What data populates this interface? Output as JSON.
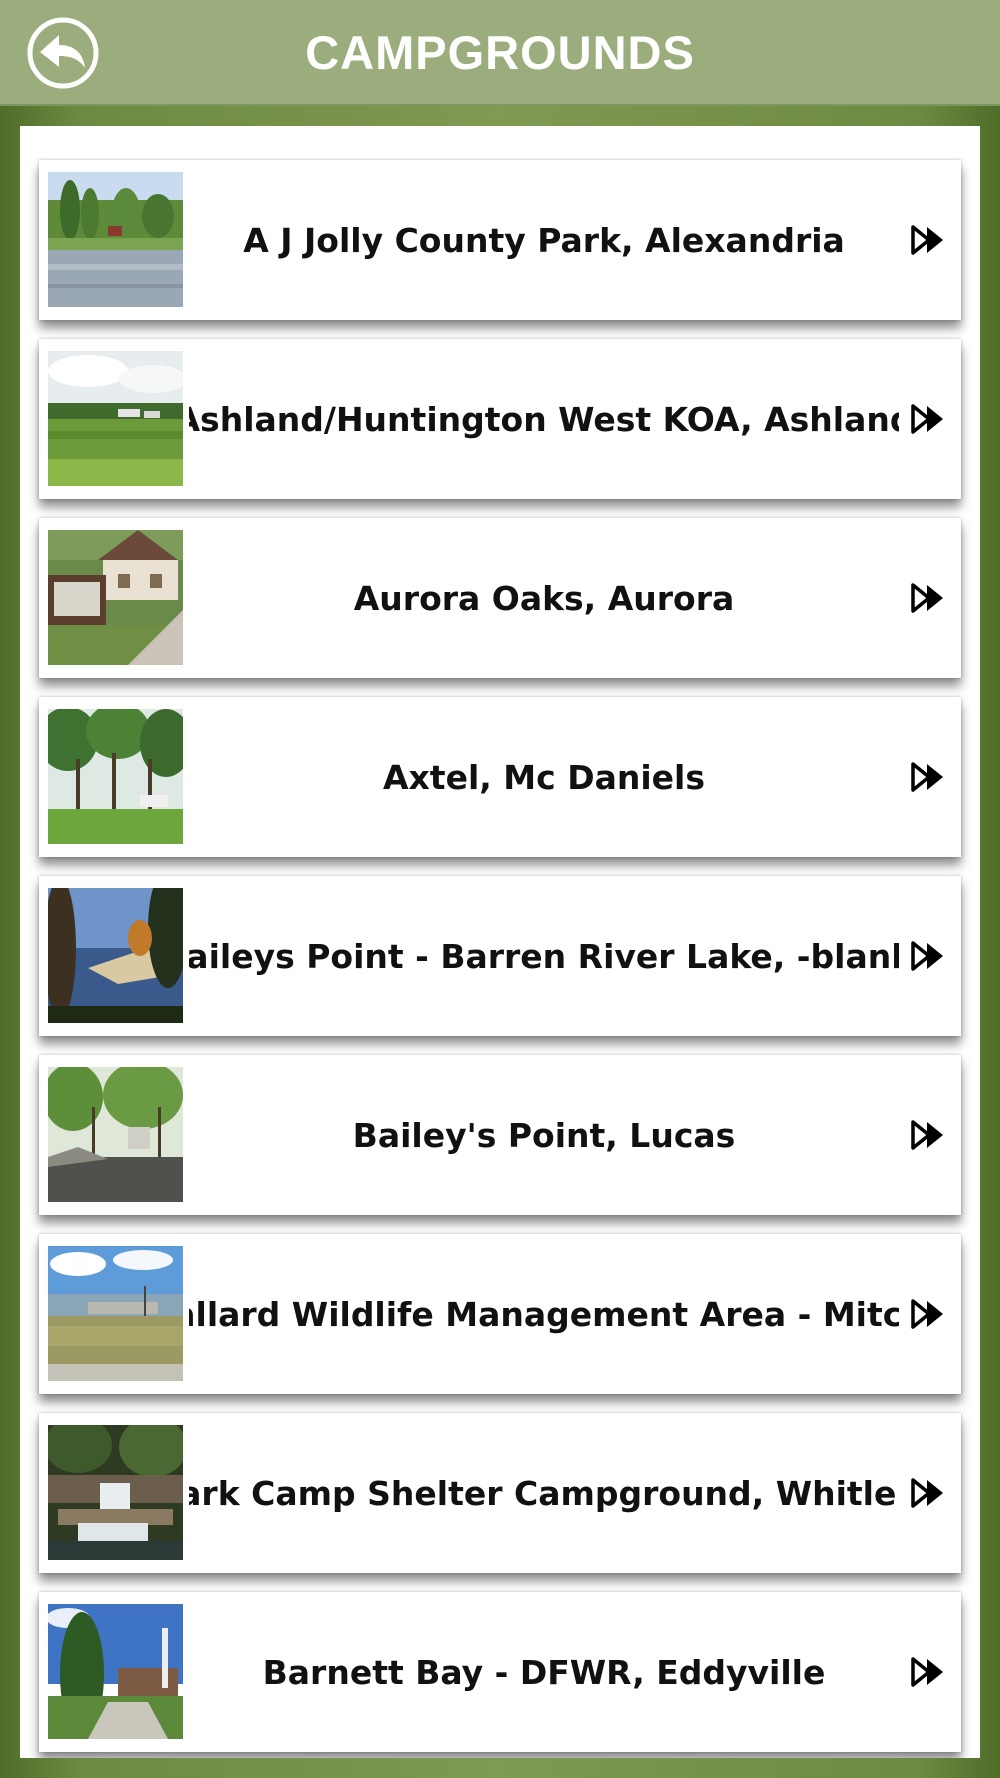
{
  "header": {
    "title": "CAMPGROUNDS",
    "back_icon": "back-arrow-icon"
  },
  "colors": {
    "header_bg": "#9bad7c",
    "frame": "#6d8a41",
    "title_text": "#ffffff",
    "row_text": "#111111"
  },
  "campgrounds": [
    {
      "name": "A J Jolly County Park, Alexandria",
      "thumb": "lake-trees-photo"
    },
    {
      "name": "Ashland/Huntington West KOA, Ashland",
      "thumb": "meadow-rv-photo"
    },
    {
      "name": "Aurora Oaks, Aurora",
      "thumb": "office-sign-photo"
    },
    {
      "name": "Axtel, Mc Daniels",
      "thumb": "forest-campsite-photo"
    },
    {
      "name": "Baileys Point - Barren River Lake, -blank-",
      "thumb": "lakeshore-photo"
    },
    {
      "name": "Bailey's Point, Lucas",
      "thumb": "paved-campsite-photo"
    },
    {
      "name": "Ballard Wildlife Management Area - Mitc...",
      "thumb": "marina-photo"
    },
    {
      "name": "Bark Camp Shelter Campground, Whitle...",
      "thumb": "waterfall-photo"
    },
    {
      "name": "Barnett Bay - DFWR, Eddyville",
      "thumb": "house-driveway-photo"
    }
  ],
  "row_icon": "double-chevron-right-icon"
}
